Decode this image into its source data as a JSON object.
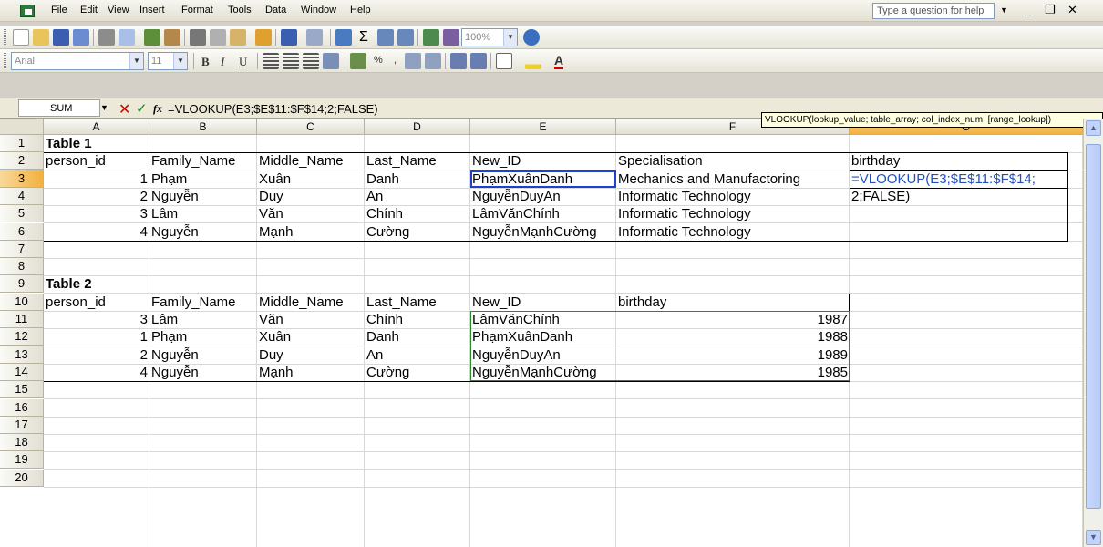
{
  "menu": [
    "File",
    "Edit",
    "View",
    "Insert",
    "Format",
    "Tools",
    "Data",
    "Window",
    "Help"
  ],
  "help_placeholder": "Type a question for help",
  "toolbar": {
    "zoom": "100%",
    "font": "Arial",
    "font_size": "11"
  },
  "formula_bar": {
    "name_box": "SUM",
    "formula": "=VLOOKUP(E3;$E$11:$F$14;2;FALSE)"
  },
  "columns": [
    "A",
    "B",
    "C",
    "D",
    "E",
    "F",
    "G"
  ],
  "rows": [
    "1",
    "2",
    "3",
    "4",
    "5",
    "6",
    "7",
    "8",
    "9",
    "10",
    "11",
    "12",
    "13",
    "14",
    "15",
    "16",
    "17",
    "18",
    "19",
    "20"
  ],
  "table1": {
    "title": "Table 1",
    "headers": [
      "person_id",
      "Family_Name",
      "Middle_Name",
      "Last_Name",
      "New_ID",
      "Specialisation",
      "birthday"
    ],
    "rows": [
      [
        "1",
        "Phạm",
        "Xuân",
        "Danh",
        "PhạmXuânDanh",
        "Mechanics and Manufactoring"
      ],
      [
        "2",
        "Nguyễn",
        "Duy",
        "An",
        "NguyễnDuyAn",
        "Informatic Technology"
      ],
      [
        "3",
        "Lâm",
        "Văn",
        "Chính",
        "LâmVănChính",
        "Informatic Technology"
      ],
      [
        "4",
        "Nguyễn",
        "Mạnh",
        "Cường",
        "NguyễnMạnhCường",
        "Informatic Technology"
      ]
    ],
    "editing_line1": "=VLOOKUP(E3;$E$11:$F$14;",
    "editing_line2": "2;FALSE)"
  },
  "table2": {
    "title": "Table 2",
    "headers": [
      "person_id",
      "Family_Name",
      "Middle_Name",
      "Last_Name",
      "New_ID",
      "birthday"
    ],
    "rows": [
      [
        "3",
        "Lâm",
        "Văn",
        "Chính",
        "LâmVănChính",
        "1987"
      ],
      [
        "1",
        "Phạm",
        "Xuân",
        "Danh",
        "PhạmXuânDanh",
        "1988"
      ],
      [
        "2",
        "Nguyễn",
        "Duy",
        "An",
        "NguyễnDuyAn",
        "1989"
      ],
      [
        "4",
        "Nguyễn",
        "Mạnh",
        "Cường",
        "NguyễnMạnhCường",
        "1985"
      ]
    ]
  },
  "tooltip": "VLOOKUP(lookup_value; table_array; col_index_num; [range_lookup])"
}
